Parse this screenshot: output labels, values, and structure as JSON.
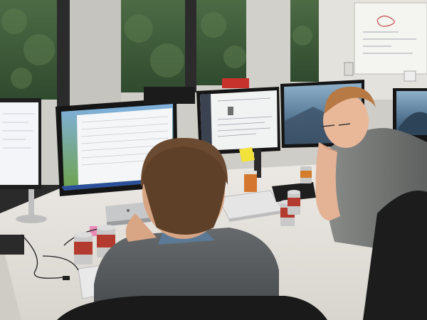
{
  "scene": {
    "kind": "office photo",
    "palette": {
      "desk": "#e8e6e1",
      "window_foliage": "#3f5e3a",
      "wall": "#d9d8d3",
      "sweater_grey": "#5b5e60",
      "tshirt_grey": "#7a7c7b",
      "hair_brown": "#6a4a30",
      "hair_ginger": "#b87a45",
      "can_red": "#b23a2e",
      "sticky_note": "#f2e23a"
    }
  }
}
